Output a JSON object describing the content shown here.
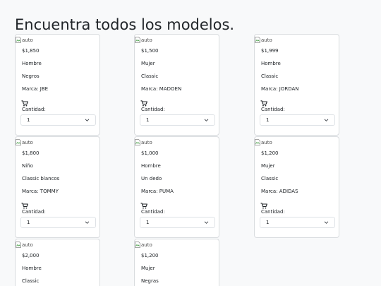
{
  "page": {
    "title": "Encuentra todos los modelos."
  },
  "labels": {
    "brand_prefix": "Marca:",
    "quantity": "Cantidad:"
  },
  "icons": {
    "image": "broken-image-icon",
    "cart": "cart-icon",
    "select": "chevron-down-icon"
  },
  "cards": [
    {
      "img_alt": "auto",
      "price": "$1,850",
      "gender": "Hombre",
      "style": "Negros",
      "brand": "JBE",
      "quantity": "1"
    },
    {
      "img_alt": "auto",
      "price": "$1,500",
      "gender": "Mujer",
      "style": "Classic",
      "brand": "MADOEN",
      "quantity": "1"
    },
    {
      "img_alt": "auto",
      "price": "$1,999",
      "gender": "Hombre",
      "style": "Classic",
      "brand": "JORDAN",
      "quantity": "1"
    },
    {
      "img_alt": "auto",
      "price": "$1,800",
      "gender": "Niño",
      "style": "Classic blancos",
      "brand": "TOMMY",
      "quantity": "1"
    },
    {
      "img_alt": "auto",
      "price": "$1,000",
      "gender": "Hombre",
      "style": "Un dedo",
      "brand": "PUMA",
      "quantity": "1"
    },
    {
      "img_alt": "auto",
      "price": "$1,200",
      "gender": "Mujer",
      "style": "Classic",
      "brand": "ADIDAS",
      "quantity": "1"
    },
    {
      "img_alt": "auto",
      "price": "$2,000",
      "gender": "Hombre",
      "style": "Classic"
    },
    {
      "img_alt": "auto",
      "price": "$1,200",
      "gender": "Mujer",
      "style": "Negras"
    }
  ]
}
